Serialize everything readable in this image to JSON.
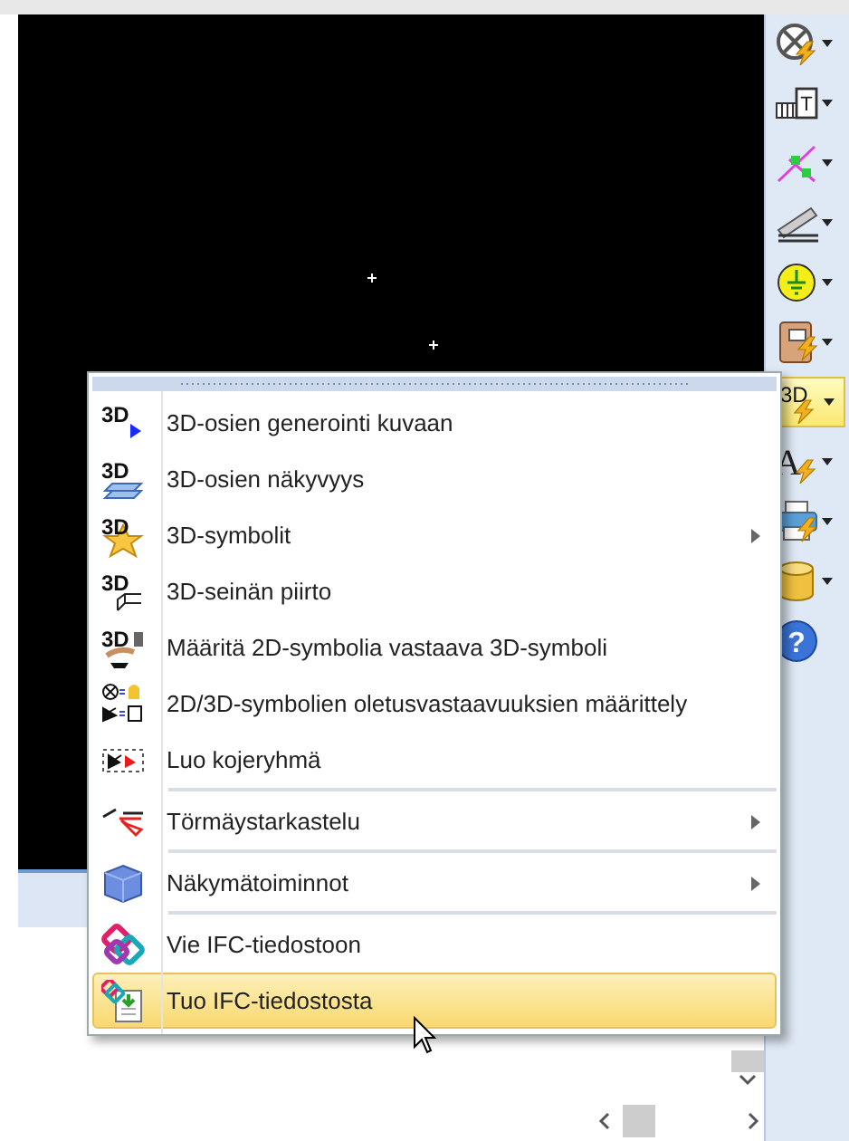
{
  "toolbar": {
    "buttons": [
      {
        "dropdown": true,
        "selected": false
      },
      {
        "icon_label": "T",
        "dropdown": true,
        "selected": false
      },
      {
        "dropdown": true,
        "selected": false
      },
      {
        "dropdown": true,
        "selected": false
      },
      {
        "dropdown": true,
        "selected": false
      },
      {
        "dropdown": true,
        "selected": false
      },
      {
        "icon_label": "3D",
        "dropdown": true,
        "selected": true
      },
      {
        "icon_label": "A",
        "dropdown": true,
        "selected": false
      },
      {
        "dropdown": true,
        "selected": false
      },
      {
        "dropdown": true,
        "selected": false
      },
      {
        "icon_label": "?",
        "dropdown": false,
        "selected": false
      }
    ]
  },
  "menu": {
    "items": [
      {
        "label": "3D-osien generointi kuvaan",
        "icon_label": "3D",
        "submenu": false,
        "separator_before": false,
        "selected": false
      },
      {
        "label": "3D-osien näkyvyys",
        "icon_label": "3D",
        "submenu": false,
        "separator_before": false,
        "selected": false
      },
      {
        "label": "3D-symbolit",
        "icon_label": "3D",
        "submenu": true,
        "separator_before": false,
        "selected": false
      },
      {
        "label": "3D-seinän piirto",
        "icon_label": "3D",
        "submenu": false,
        "separator_before": false,
        "selected": false
      },
      {
        "label": "Määritä 2D-symbolia vastaava 3D-symboli",
        "icon_label": "3D",
        "submenu": false,
        "separator_before": false,
        "selected": false
      },
      {
        "label": "2D/3D-symbolien oletusvastaavuuksien määrittely",
        "submenu": false,
        "separator_before": false,
        "selected": false
      },
      {
        "label": "Luo kojeryhmä",
        "submenu": false,
        "separator_before": false,
        "selected": false
      },
      {
        "label": "Törmäystarkastelu",
        "submenu": true,
        "separator_before": true,
        "selected": false
      },
      {
        "label": "Näkymätoiminnot",
        "submenu": true,
        "separator_before": true,
        "selected": false
      },
      {
        "label": "Vie IFC-tiedostoon",
        "submenu": false,
        "separator_before": true,
        "selected": false
      },
      {
        "label": "Tuo IFC-tiedostosta",
        "submenu": false,
        "separator_before": false,
        "selected": true
      }
    ]
  }
}
